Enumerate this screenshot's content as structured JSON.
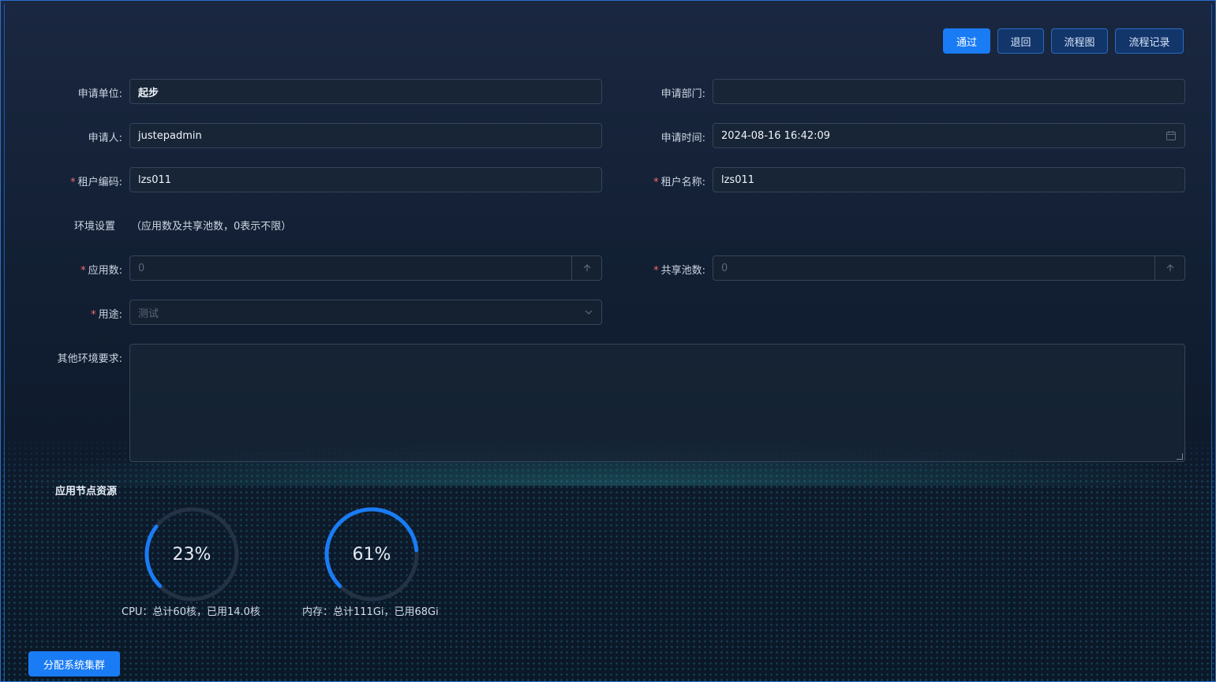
{
  "toolbar": {
    "approve": "通过",
    "reject": "退回",
    "flowchart": "流程图",
    "flow_record": "流程记录"
  },
  "form": {
    "applicant_unit": {
      "label": "申请单位:",
      "value": "起步"
    },
    "applicant_dept": {
      "label": "申请部门:",
      "value": ""
    },
    "applicant": {
      "label": "申请人:",
      "value": "justepadmin"
    },
    "apply_time": {
      "label": "申请时间:",
      "value": "2024-08-16 16:42:09"
    },
    "tenant_code": {
      "label": "租户编码:",
      "value": "lzs011",
      "required": true
    },
    "tenant_name": {
      "label": "租户名称:",
      "value": "lzs011",
      "required": true
    },
    "env_settings": {
      "label": "环境设置",
      "note": "（应用数及共享池数，0表示不限）"
    },
    "app_count": {
      "label": "应用数:",
      "value": "0",
      "required": true
    },
    "shared_pool_count": {
      "label": "共享池数:",
      "value": "0",
      "required": true
    },
    "purpose": {
      "label": "用途:",
      "value": "测试",
      "required": true
    },
    "other_requirements": {
      "label": "其他环境要求:",
      "value": ""
    }
  },
  "resources": {
    "title": "应用节点资源",
    "cpu": {
      "percent": 23,
      "percent_label": "23%",
      "caption": "CPU：总计60核，已用14.0核"
    },
    "memory": {
      "percent": 61,
      "percent_label": "61%",
      "caption": "内存：总计111Gi，已用68Gi"
    }
  },
  "allocate_button": "分配系统集群",
  "colors": {
    "primary": "#1a7cf5",
    "gauge_track": "#243246",
    "required": "#f56c6c"
  }
}
